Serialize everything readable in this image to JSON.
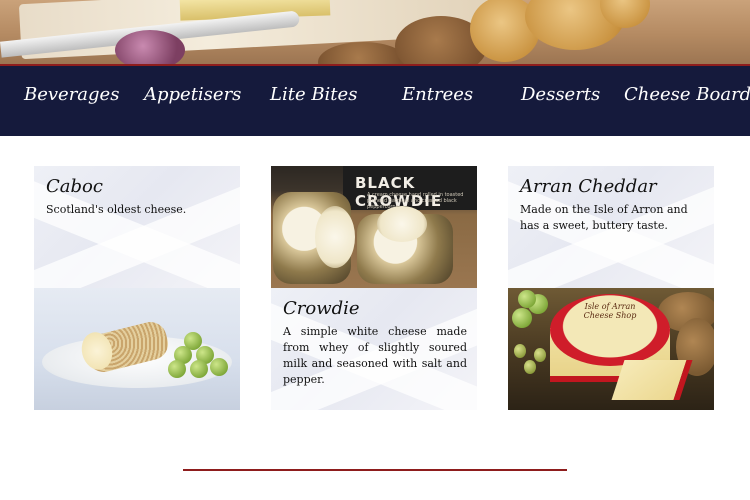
{
  "nav": {
    "items": [
      "Beverages",
      "Appetisers",
      "Lite Bites",
      "Entrees",
      "Desserts",
      "Cheese Board"
    ]
  },
  "cards": [
    {
      "title": "Caboc",
      "description": "Scotland's oldest cheese."
    },
    {
      "title": "Crowdie",
      "description": "A simple white cheese made from whey of slightly soured milk and seasoned with salt and pepper.",
      "package_label": "BLACK CROWDIE",
      "package_subtext": "A cream cheese hand rolled in toasted pinhead oatmeal and crushed black peppercorns"
    },
    {
      "title": "Arran Cheddar",
      "description": "Made on the Isle of Arron and has a sweet, buttery taste.",
      "package_label": "Isle of Arran Cheese Shop"
    }
  ],
  "colors": {
    "nav_background": "#151a3c",
    "accent_red": "#8e1d1d",
    "nav_text": "#ffffff"
  }
}
